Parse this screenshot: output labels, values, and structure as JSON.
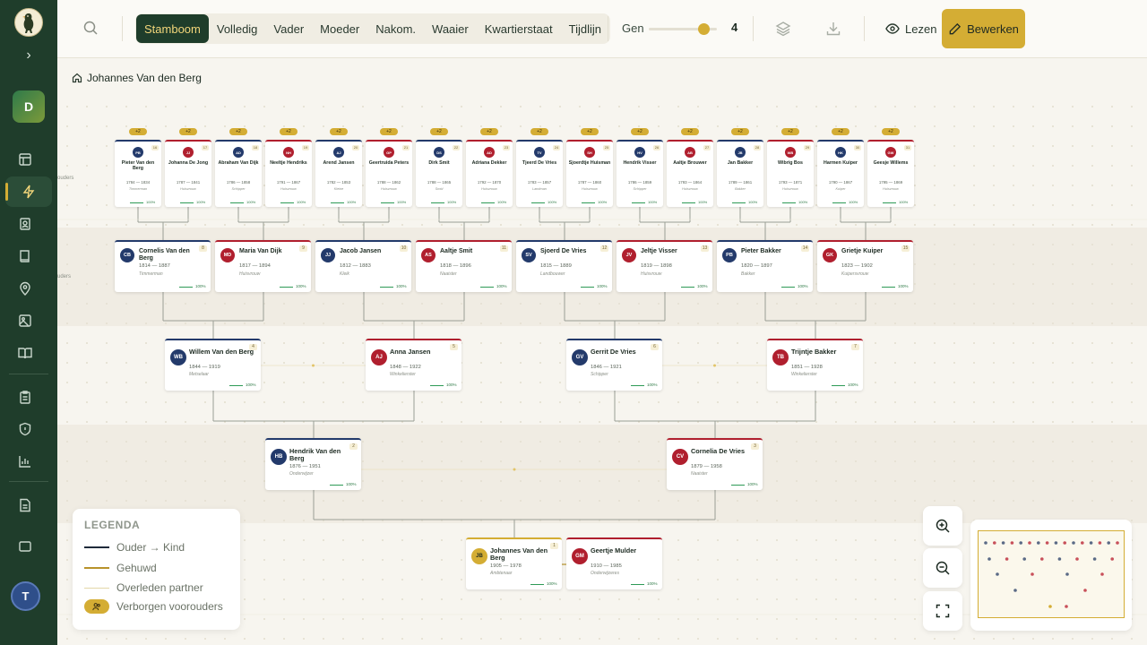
{
  "toolbar": {
    "tabs": [
      "Stamboom",
      "Volledig",
      "Vader",
      "Moeder",
      "Nakom.",
      "Waaier",
      "Kwartierstaat",
      "Tijdlijn"
    ],
    "active_tab": "Stamboom",
    "gen_label": "Gen",
    "gen_value": "4",
    "gen_level": 0.8,
    "read_label": "Lezen",
    "edit_label": "Bewerken"
  },
  "sidebar": {
    "workspace_initial": "D",
    "user_initial": "T"
  },
  "breadcrumb": {
    "label": "Johannes Van den Berg"
  },
  "canvas": {
    "side_labels": [
      "ouders",
      "uders"
    ],
    "gen5": [
      {
        "initials": "PB",
        "name": "Pieter Van den Berg",
        "dates": "1784 — 1834",
        "occ": "Timmerman",
        "num": "16",
        "sex": "m",
        "badge": "+2"
      },
      {
        "initials": "JJ",
        "name": "Johanna De Jong",
        "dates": "1787 — 1841",
        "occ": "Huisvrouw",
        "num": "17",
        "sex": "f",
        "badge": "+2"
      },
      {
        "initials": "AD",
        "name": "Abraham Van Dijk",
        "dates": "1786 — 1858",
        "occ": "Schipper",
        "num": "18",
        "sex": "m",
        "badge": "+2"
      },
      {
        "initials": "NH",
        "name": "Neeltje Hendriks",
        "dates": "1791 — 1867",
        "occ": "Huisvrouw",
        "num": "19",
        "sex": "f",
        "badge": "+2"
      },
      {
        "initials": "AJ",
        "name": "Arend Jansen",
        "dates": "1782 — 1853",
        "occ": "Kleine",
        "num": "20",
        "sex": "m",
        "badge": "+2"
      },
      {
        "initials": "GP",
        "name": "Geertruida Peters",
        "dates": "1788 — 1862",
        "occ": "Huisvrouw",
        "num": "21",
        "sex": "f",
        "badge": "+2"
      },
      {
        "initials": "DS",
        "name": "Dirk Smit",
        "dates": "1788 — 1865",
        "occ": "Smid",
        "num": "22",
        "sex": "m",
        "badge": "+2"
      },
      {
        "initials": "AD",
        "name": "Adriana Dekker",
        "dates": "1792 — 1870",
        "occ": "Huisvrouw",
        "num": "23",
        "sex": "f",
        "badge": "+2"
      },
      {
        "initials": "TV",
        "name": "Tjeerd De Vries",
        "dates": "1783 — 1857",
        "occ": "Landman",
        "num": "24",
        "sex": "m",
        "badge": "+2"
      },
      {
        "initials": "SH",
        "name": "Sjoerdtje Huisman",
        "dates": "1787 — 1860",
        "occ": "Huisvrouw",
        "num": "25",
        "sex": "f",
        "badge": "+2"
      },
      {
        "initials": "HV",
        "name": "Hendrik Visser",
        "dates": "1786 — 1859",
        "occ": "Schipper",
        "num": "26",
        "sex": "m",
        "badge": "+2"
      },
      {
        "initials": "AB",
        "name": "Aaltje Brouwer",
        "dates": "1793 — 1864",
        "occ": "Huisvrouw",
        "num": "27",
        "sex": "f",
        "badge": "+2"
      },
      {
        "initials": "JB",
        "name": "Jan Bakker",
        "dates": "1789 — 1861",
        "occ": "Bakker",
        "num": "28",
        "sex": "m",
        "badge": "+2"
      },
      {
        "initials": "WB",
        "name": "Wibrig Bos",
        "dates": "1793 — 1871",
        "occ": "Huisvrouw",
        "num": "29",
        "sex": "f",
        "badge": "+2"
      },
      {
        "initials": "HK",
        "name": "Harmen Kuiper",
        "dates": "1790 — 1867",
        "occ": "Kuiper",
        "num": "30",
        "sex": "m",
        "badge": "+2"
      },
      {
        "initials": "GW",
        "name": "Geesje Willems",
        "dates": "1795 — 1869",
        "occ": "Huisvrouw",
        "num": "31",
        "sex": "f",
        "badge": "+2"
      }
    ],
    "gen4": [
      {
        "initials": "CB",
        "name": "Cornelis Van den Berg",
        "dates": "1814 — 1887",
        "occ": "Timmerman",
        "num": "8",
        "sex": "m"
      },
      {
        "initials": "MD",
        "name": "Maria Van Dijk",
        "dates": "1817 — 1894",
        "occ": "Huisvrouw",
        "num": "9",
        "sex": "f"
      },
      {
        "initials": "JJ",
        "name": "Jacob Jansen",
        "dates": "1812 — 1883",
        "occ": "Kleik",
        "num": "10",
        "sex": "m"
      },
      {
        "initials": "AS",
        "name": "Aaltje Smit",
        "dates": "1818 — 1896",
        "occ": "Naaister",
        "num": "11",
        "sex": "f"
      },
      {
        "initials": "SV",
        "name": "Sjoerd De Vries",
        "dates": "1815 — 1889",
        "occ": "Landbouwer",
        "num": "12",
        "sex": "m"
      },
      {
        "initials": "JV",
        "name": "Jeltje Visser",
        "dates": "1819 — 1898",
        "occ": "Huisvrouw",
        "num": "13",
        "sex": "f"
      },
      {
        "initials": "PB",
        "name": "Pieter Bakker",
        "dates": "1820 — 1897",
        "occ": "Bakker",
        "num": "14",
        "sex": "m"
      },
      {
        "initials": "GK",
        "name": "Grietje Kuiper",
        "dates": "1823 — 1902",
        "occ": "Kuipersvrouw",
        "num": "15",
        "sex": "f"
      }
    ],
    "gen3": [
      {
        "initials": "WB",
        "name": "Willem Van den Berg",
        "dates": "1844 — 1919",
        "occ": "Metselaar",
        "num": "4",
        "sex": "m"
      },
      {
        "initials": "AJ",
        "name": "Anna Jansen",
        "dates": "1848 — 1922",
        "occ": "Winkelierster",
        "num": "5",
        "sex": "f"
      },
      {
        "initials": "GV",
        "name": "Gerrit De Vries",
        "dates": "1846 — 1921",
        "occ": "Schipper",
        "num": "6",
        "sex": "m"
      },
      {
        "initials": "TB",
        "name": "Trijntje Bakker",
        "dates": "1851 — 1928",
        "occ": "Winkelierster",
        "num": "7",
        "sex": "f"
      }
    ],
    "gen2": [
      {
        "initials": "HB",
        "name": "Hendrik Van den Berg",
        "dates": "1876 — 1951",
        "occ": "Onderwijzer",
        "num": "2",
        "sex": "m"
      },
      {
        "initials": "CV",
        "name": "Cornelia De Vries",
        "dates": "1879 — 1958",
        "occ": "Naaister",
        "num": "3",
        "sex": "f"
      }
    ],
    "gen1": [
      {
        "initials": "JB",
        "name": "Johannes Van den Berg",
        "dates": "1905 — 1978",
        "occ": "Ambtenaar",
        "num": "1",
        "sex": "me"
      },
      {
        "initials": "GM",
        "name": "Geertje Mulder",
        "dates": "1910 — 1985",
        "occ": "Onderwijzeres",
        "num": "",
        "sex": "f"
      }
    ],
    "pct": "100%"
  },
  "legend": {
    "title": "LEGENDA",
    "items": [
      {
        "label": "Ouder → Kind",
        "color": "#1f2a3a"
      },
      {
        "label": "Gehuwd",
        "color": "#b8922a"
      },
      {
        "label": "Overleden partner",
        "color": "#e3d7a8"
      },
      {
        "label": "Verborgen voorouders",
        "color": "#d4ad34"
      }
    ]
  },
  "colors": {
    "sidebar": "#1f3d2b",
    "accent": "#d4ad34",
    "male": "#233a6b",
    "female": "#b01f2e"
  },
  "icons": {
    "sidebar": [
      "home-icon",
      "zap-icon",
      "contact-icon",
      "book-icon",
      "map-pin-icon",
      "image-icon",
      "book-open-icon",
      "clipboard-icon",
      "shield-icon",
      "chart-icon",
      "file-icon"
    ]
  }
}
